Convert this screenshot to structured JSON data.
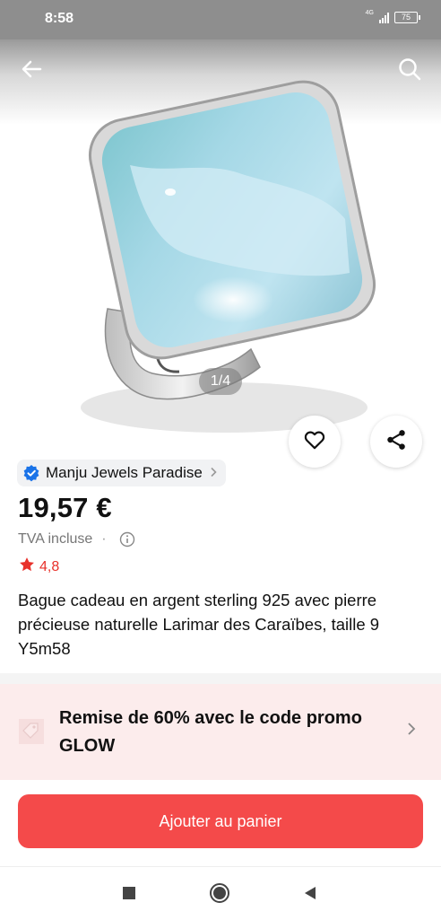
{
  "status_bar": {
    "time": "8:58",
    "network": "4G",
    "battery": "75"
  },
  "gallery": {
    "indicator": "1/4"
  },
  "store": {
    "name": "Manju Jewels Paradise"
  },
  "product": {
    "price": "19,57 €",
    "vat": "TVA incluse",
    "separator": "·",
    "rating": "4,8",
    "title": "Bague cadeau en argent sterling 925 avec pierre précieuse naturelle Larimar des Caraïbes, taille 9 Y5m58"
  },
  "promo": {
    "text": "Remise de 60% avec le code promo GLOW"
  },
  "cart": {
    "label": "Ajouter au panier"
  },
  "colors": {
    "accent": "#f44a4a",
    "rating": "#e8312b",
    "promo_bg": "#fcecec",
    "verified": "#1a73e8"
  },
  "icons": [
    "back-arrow-icon",
    "search-icon",
    "heart-icon",
    "share-icon",
    "verified-badge-icon",
    "info-icon",
    "star-icon",
    "coupon-icon",
    "chevron-right-icon"
  ]
}
